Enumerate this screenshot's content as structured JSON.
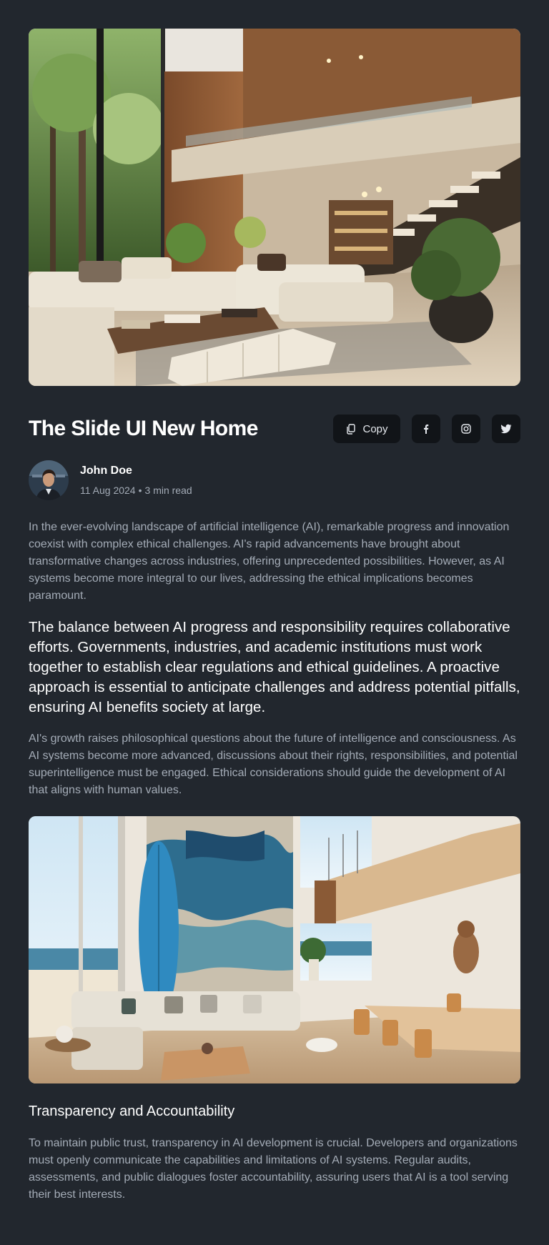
{
  "post": {
    "title": "The Slide UI New Home"
  },
  "share": {
    "copy_label": "Copy",
    "copy_icon": "copy-icon",
    "facebook_icon": "facebook-icon",
    "instagram_icon": "instagram-icon",
    "twitter_icon": "twitter-icon"
  },
  "author": {
    "name": "John Doe",
    "date": "11 Aug 2024",
    "separator": "•",
    "read_time": "3 min read"
  },
  "content": {
    "paragraph_1": "In the ever-evolving landscape of artificial intelligence (AI), remarkable progress and innovation coexist with complex ethical challenges. AI's rapid advancements have brought about transformative changes across industries, offering unprecedented possibilities. However, as AI systems become more integral to our lives, addressing the ethical implications becomes paramount.",
    "lead": "The balance between AI progress and responsibility requires collaborative efforts. Governments, industries, and academic institutions must work together to establish clear regulations and ethical guidelines. A proactive approach is essential to anticipate challenges and address potential pitfalls, ensuring AI benefits society at large.",
    "paragraph_2": "AI's growth raises philosophical questions about the future of intelligence and consciousness. As AI systems become more advanced, discussions about their rights, responsibilities, and potential superintelligence must be engaged. Ethical considerations should guide the development of AI that aligns with human values.",
    "section_title": "Transparency and Accountability",
    "paragraph_3": "To maintain public trust, transparency in AI development is crucial. Developers and organizations must openly communicate the capabilities and limitations of AI systems. Regular audits, assessments, and public dialogues foster accountability, assuring users that AI is a tool serving their best interests."
  },
  "colors": {
    "background": "#22272e",
    "button_bg": "#111418",
    "muted_text": "#a4acb7"
  }
}
